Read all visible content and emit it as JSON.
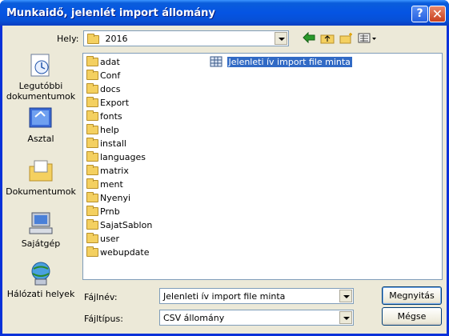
{
  "window": {
    "title": "Munkaidő, jelenlét import állomány"
  },
  "toolbar": {
    "location_label": "Hely:",
    "location_value": "2016"
  },
  "places": [
    {
      "label_line1": "Legutóbbi",
      "label_line2": "dokumentumok"
    },
    {
      "label_line1": "Asztal",
      "label_line2": ""
    },
    {
      "label_line1": "Dokumentumok",
      "label_line2": ""
    },
    {
      "label_line1": "Sajátgép",
      "label_line2": ""
    },
    {
      "label_line1": "Hálózati helyek",
      "label_line2": ""
    }
  ],
  "folders": [
    "adat",
    "Conf",
    "docs",
    "Export",
    "fonts",
    "help",
    "install",
    "languages",
    "matrix",
    "ment",
    "Nyenyi",
    "Prnb",
    "SajatSablon",
    "user",
    "webupdate"
  ],
  "selected_file": "Jelenleti ív import file minta",
  "filename": {
    "label": "Fájlnév:",
    "value": "Jelenleti ív import file minta"
  },
  "filetype": {
    "label": "Fájltípus:",
    "value": "CSV állomány"
  },
  "buttons": {
    "open": "Megnyitás",
    "cancel": "Mégse"
  },
  "colors": {
    "title_bar": "#0554e3",
    "dialog_bg": "#ece9d8",
    "selection": "#316ac5",
    "folder": "#f4d060"
  }
}
